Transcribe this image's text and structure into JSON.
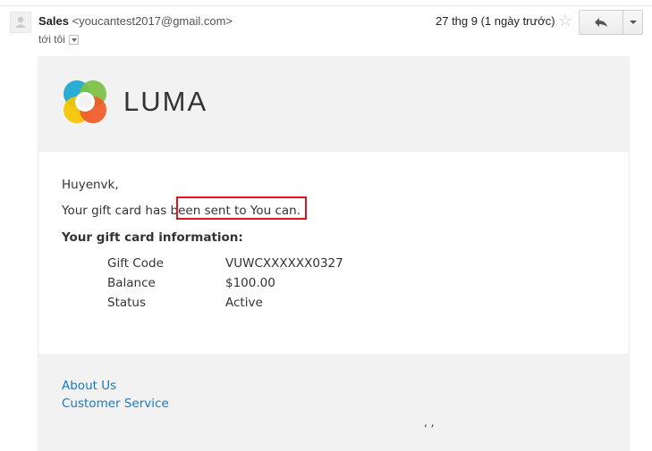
{
  "message": {
    "sender_name": "Sales",
    "sender_email": "<youcantest2017@gmail.com>",
    "recipient": "tới tôi",
    "date": "27 thg 9 (1 ngày trước)"
  },
  "icons": {
    "avatar": "person-icon",
    "star": "star-icon",
    "reply": "reply-arrow-icon",
    "more": "chevron-down-icon"
  },
  "email": {
    "brand": "LUMA",
    "greeting": "Huyenvk,",
    "sent_line": "Your gift card has been sent to You can.",
    "info_heading": "Your gift card information:",
    "rows": [
      {
        "label": "Gift Code",
        "value": "VUWCXXXXXX0327"
      },
      {
        "label": "Balance",
        "value": "$100.00"
      },
      {
        "label": "Status",
        "value": "Active"
      }
    ],
    "footer_links": [
      "About Us",
      "Customer Service"
    ],
    "footer_address": ", ,"
  },
  "colors": {
    "link": "#1979c3",
    "highlight": "#e0141e",
    "panel": "#f2f2f2"
  }
}
